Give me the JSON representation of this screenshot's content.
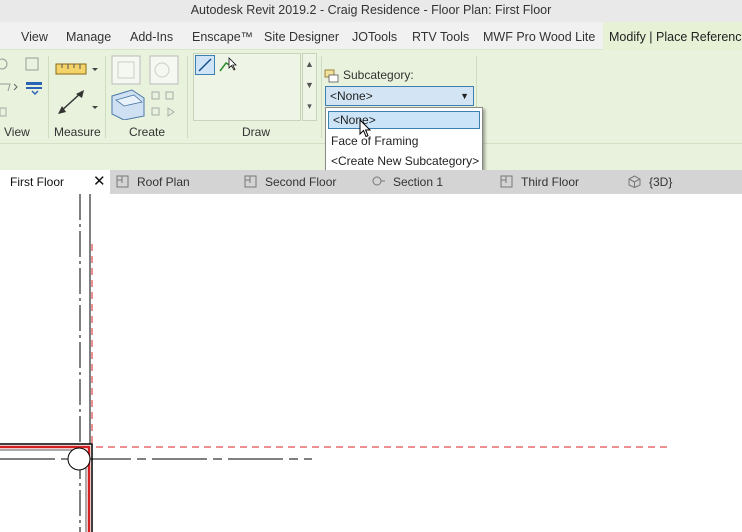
{
  "window": {
    "title": "Autodesk Revit 2019.2 - Craig Residence - Floor Plan: First Floor"
  },
  "menu": {
    "tabs": [
      "View",
      "Manage",
      "Add-Ins",
      "Enscape™",
      "Site Designer",
      "JOTools",
      "RTV Tools",
      "MWF Pro Wood Lite",
      "Modify | Place Reference"
    ],
    "active_tab": "Modify | Place Reference"
  },
  "ribbon": {
    "panels": {
      "view": "View",
      "measure": "Measure",
      "create": "Create",
      "draw": "Draw"
    },
    "subcategory": {
      "label": "Subcategory:",
      "value": "<None>",
      "options": [
        "<None>",
        "Face of Framing",
        "<Create New Subcategory>"
      ],
      "highlighted": "<None>"
    }
  },
  "view_tabs": [
    {
      "label": "First Floor",
      "active": true,
      "icon": "floor-plan-icon"
    },
    {
      "label": "Roof Plan",
      "active": false,
      "icon": "floor-plan-icon"
    },
    {
      "label": "Second Floor",
      "active": false,
      "icon": "floor-plan-icon"
    },
    {
      "label": "Section 1",
      "active": false,
      "icon": "section-icon"
    },
    {
      "label": "Third Floor",
      "active": false,
      "icon": "floor-plan-icon"
    },
    {
      "label": "{3D}",
      "active": false,
      "icon": "3d-view-icon"
    }
  ],
  "colors": {
    "ribbon_bg": "#e8f2dc",
    "selection_blue": "#3c7fb1",
    "reference_plane_red": "#d42020"
  }
}
